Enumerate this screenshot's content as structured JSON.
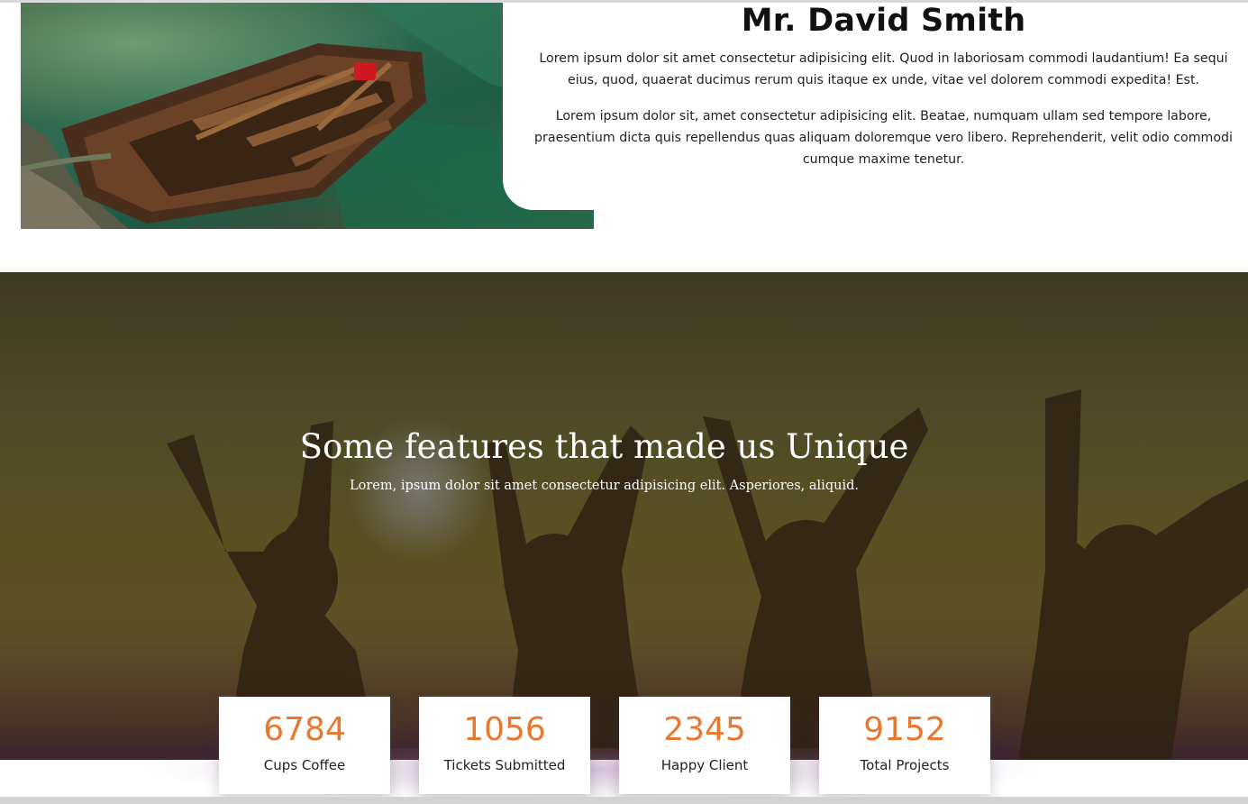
{
  "about": {
    "photo_alt": "Wooden rowboat on a green lake",
    "title": "Mr. David Smith",
    "paragraphs": [
      "Lorem ipsum dolor sit amet consectetur adipisicing elit. Quod in laboriosam commodi laudantium! Ea sequi eius, quod, quaerat ducimus rerum quis itaque ex unde, vitae vel dolorem commodi expedita! Est.",
      "Lorem ipsum dolor sit, amet consectetur adipisicing elit. Beatae, numquam ullam sed tempore labore, praesentium dicta quis repellendus quas aliquam doloremque vero libero. Reprehenderit, velit odio commodi cumque maxime tenetur."
    ]
  },
  "features": {
    "title": "Some features that made us Unique",
    "subtitle": "Lorem, ipsum dolor sit amet consectetur adipisicing elit. Asperiores, aliquid."
  },
  "stats": [
    {
      "value": "6784",
      "label": "Cups Coffee"
    },
    {
      "value": "1056",
      "label": "Tickets Submitted"
    },
    {
      "value": "2345",
      "label": "Happy Client"
    },
    {
      "value": "9152",
      "label": "Total Projects"
    }
  ],
  "colors": {
    "accent": "#e8782f",
    "heading": "#111111",
    "hero_overlay": "#4f4a26"
  }
}
